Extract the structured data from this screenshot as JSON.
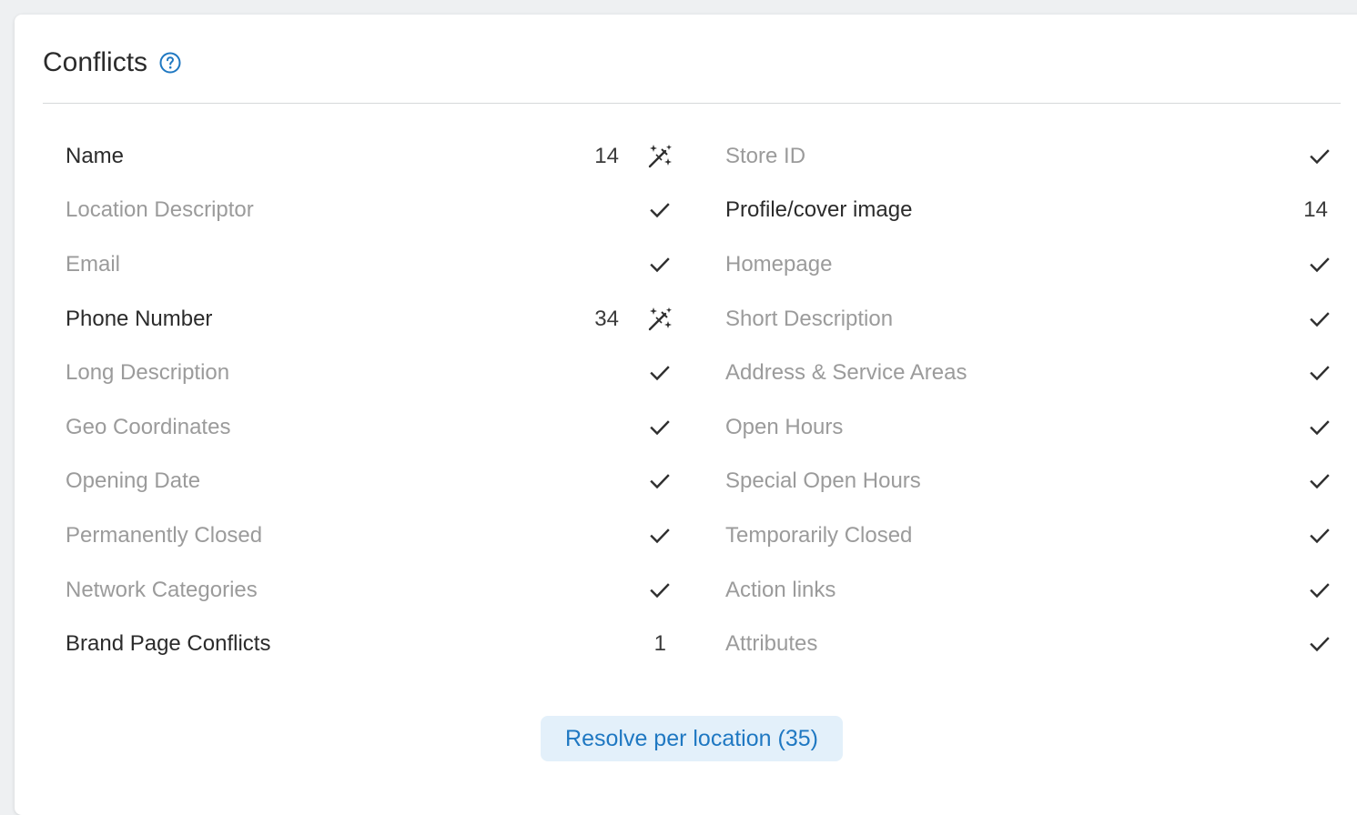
{
  "header": {
    "title": "Conflicts",
    "help_icon": "help-circle-icon"
  },
  "colors": {
    "accent": "#1f78c2",
    "muted_text": "#9b9b9b",
    "strong_text": "#2b2b2b",
    "button_bg": "#e3f0fa"
  },
  "left_column": [
    {
      "label": "Name",
      "count": "14",
      "status": "conflict",
      "action_icon": "magic-wand-icon"
    },
    {
      "label": "Location Descriptor",
      "status": "ok",
      "status_icon": "check-icon"
    },
    {
      "label": "Email",
      "status": "ok",
      "status_icon": "check-icon"
    },
    {
      "label": "Phone Number",
      "count": "34",
      "status": "conflict",
      "action_icon": "magic-wand-icon"
    },
    {
      "label": "Long Description",
      "status": "ok",
      "status_icon": "check-icon"
    },
    {
      "label": "Geo Coordinates",
      "status": "ok",
      "status_icon": "check-icon"
    },
    {
      "label": "Opening Date",
      "status": "ok",
      "status_icon": "check-icon"
    },
    {
      "label": "Permanently Closed",
      "status": "ok",
      "status_icon": "check-icon"
    },
    {
      "label": "Network Categories",
      "status": "ok",
      "status_icon": "check-icon"
    },
    {
      "label": "Brand Page Conflicts",
      "count": "1",
      "status": "conflict"
    }
  ],
  "right_column": [
    {
      "label": "Store ID",
      "status": "ok",
      "status_icon": "check-icon"
    },
    {
      "label": "Profile/cover image",
      "count": "14",
      "status": "conflict"
    },
    {
      "label": "Homepage",
      "status": "ok",
      "status_icon": "check-icon"
    },
    {
      "label": "Short Description",
      "status": "ok",
      "status_icon": "check-icon"
    },
    {
      "label": "Address & Service Areas",
      "status": "ok",
      "status_icon": "check-icon"
    },
    {
      "label": "Open Hours",
      "status": "ok",
      "status_icon": "check-icon"
    },
    {
      "label": "Special Open Hours",
      "status": "ok",
      "status_icon": "check-icon"
    },
    {
      "label": "Temporarily Closed",
      "status": "ok",
      "status_icon": "check-icon"
    },
    {
      "label": "Action links",
      "status": "ok",
      "status_icon": "check-icon"
    },
    {
      "label": "Attributes",
      "status": "ok",
      "status_icon": "check-icon"
    }
  ],
  "resolve_button": {
    "label": "Resolve per location (35)"
  }
}
